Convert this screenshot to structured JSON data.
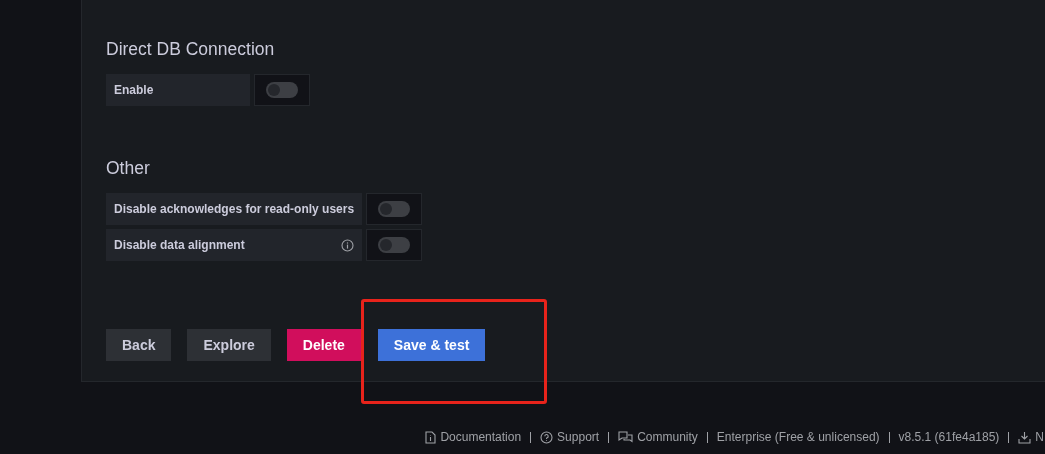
{
  "sections": [
    {
      "title": "Direct DB Connection",
      "fields": [
        {
          "label": "Enable",
          "info": false,
          "on": false
        }
      ]
    },
    {
      "title": "Other",
      "fields": [
        {
          "label": "Disable acknowledges for read-only users",
          "info": false,
          "on": false
        },
        {
          "label": "Disable data alignment",
          "info": true,
          "on": false
        }
      ]
    }
  ],
  "buttons": [
    {
      "label": "Back",
      "kind": "secondary"
    },
    {
      "label": "Explore",
      "kind": "secondary"
    },
    {
      "label": "Delete",
      "kind": "destructive"
    },
    {
      "label": "Save & test",
      "kind": "primary",
      "highlighted": true
    }
  ],
  "footer": [
    {
      "label": "Documentation",
      "kind": "document"
    },
    {
      "label": "Support",
      "kind": "help"
    },
    {
      "label": "Community",
      "kind": "chat"
    },
    {
      "label": "Enterprise (Free & unlicensed)",
      "kind": "plain"
    },
    {
      "label": "v8.5.1 (61fe4a185)",
      "kind": "plain"
    },
    {
      "label": "N",
      "kind": "download"
    }
  ]
}
